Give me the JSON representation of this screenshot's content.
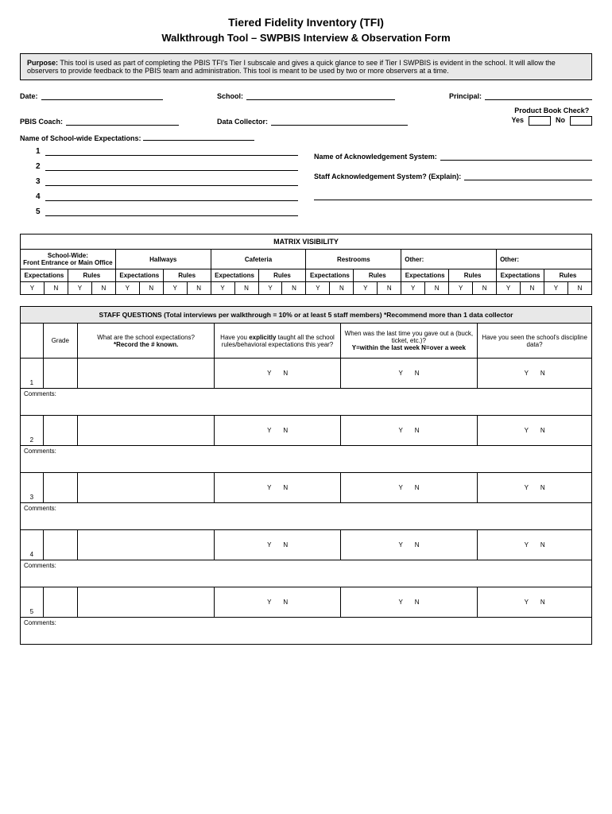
{
  "header": {
    "title": "Tiered Fidelity Inventory (TFI)",
    "subtitle": "Walkthrough Tool – SWPBIS Interview & Observation Form"
  },
  "purpose": {
    "label": "Purpose:",
    "text": " This tool is used as part of completing the PBIS TFI's Tier I subscale and gives a quick glance to see if Tier I SWPBIS is evident in the school. It will allow the observers to provide feedback to the PBIS team and administration. This tool is meant to be used by two or more observers at a time."
  },
  "fields": {
    "date": "Date:",
    "school": "School:",
    "principal": "Principal:",
    "pbis_coach": "PBIS Coach:",
    "data_collector": "Data Collector:",
    "product_book_check": "Product Book Check?",
    "yes": "Yes",
    "no": "No",
    "sw_expectations": "Name of School-wide Expectations:",
    "ack_system": "Name of Acknowledgement System:",
    "staff_ack": "Staff Acknowledgement System? (Explain):"
  },
  "exp_nums": [
    "1",
    "2",
    "3",
    "4",
    "5"
  ],
  "matrix": {
    "title": "MATRIX VISIBILITY",
    "loc1": "School-Wide:",
    "loc1b": "Front Entrance or Main Office",
    "loc2": "Hallways",
    "loc3": "Cafeteria",
    "loc4": "Restrooms",
    "loc5": "Other:",
    "loc6": "Other:",
    "expectations": "Expectations",
    "rules": "Rules",
    "y": "Y",
    "n": "N"
  },
  "staff": {
    "title": "STAFF QUESTIONS (Total interviews per walkthrough = 10% or at least 5 staff members) *Recommend more than 1 data collector",
    "grade": "Grade",
    "q1a": "What are the school expectations?",
    "q1b": "*Record the # known.",
    "q2a": "Have you ",
    "q2b": "explicitly",
    "q2c": " taught all the school rules/behavioral expectations this year?",
    "q3a": "When was the last time you gave out a (buck, ticket, etc.)?",
    "q3b": "Y=within the last week  N=over a week",
    "q4": "Have you seen the school's discipline data?",
    "y": "Y",
    "n": "N",
    "comments": "Comments:",
    "rows": [
      "1",
      "2",
      "3",
      "4",
      "5"
    ]
  }
}
